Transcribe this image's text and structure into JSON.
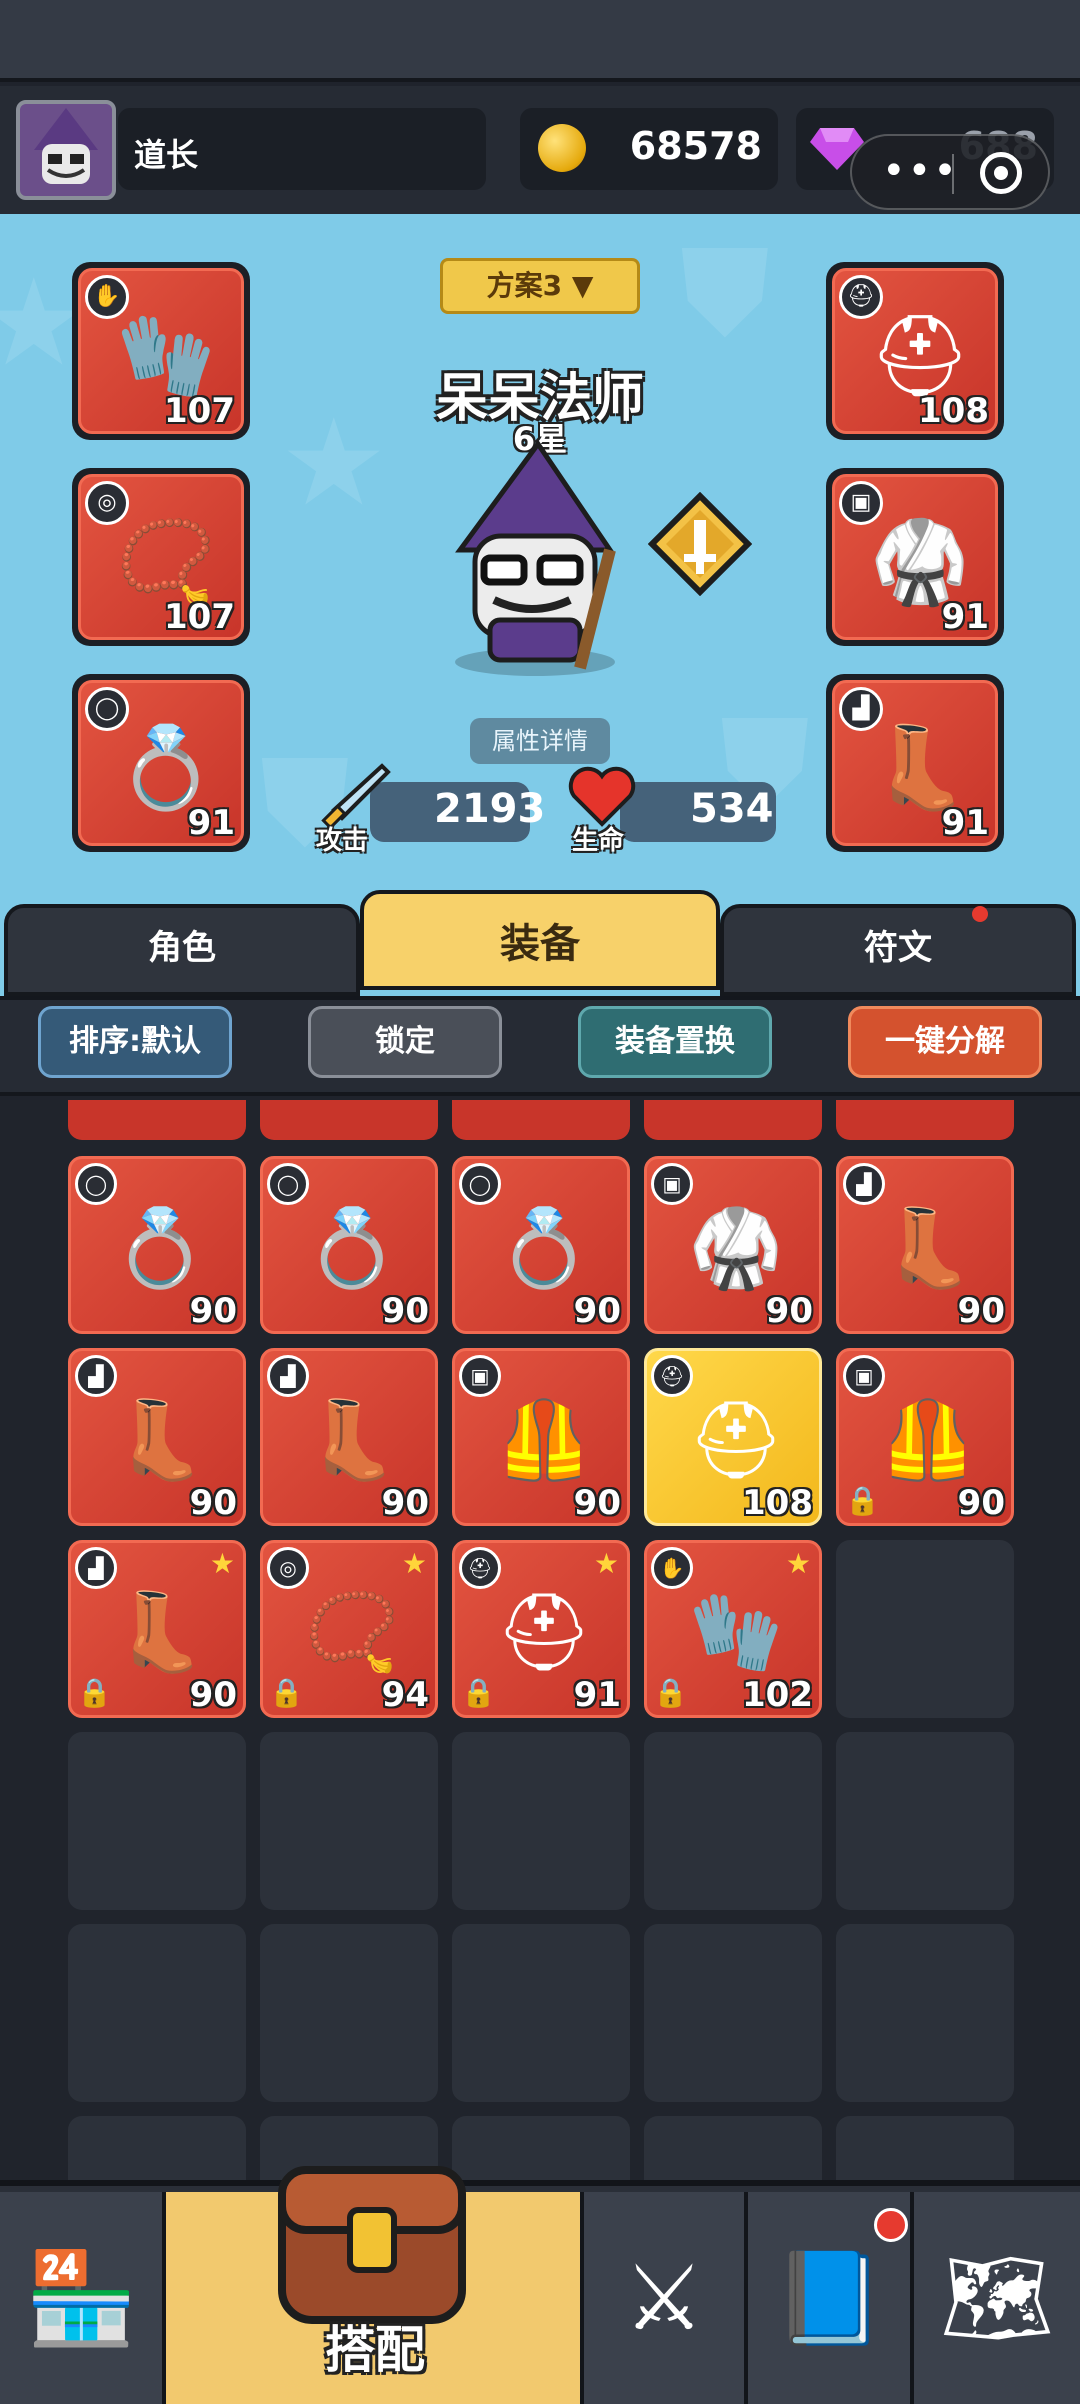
{
  "header": {
    "player_name": "道长",
    "gold": "68578",
    "gems": "688",
    "capsule_icons": [
      "more-dots-icon",
      "target-icon"
    ]
  },
  "hero": {
    "plan_label": "方案3 ▼",
    "name": "呆呆法师",
    "stars": "6星",
    "detail_button": "属性详情",
    "attack_label": "攻击",
    "attack_value": "2193",
    "hp_label": "生命",
    "hp_value": "534",
    "slots": {
      "gloves": {
        "level": "107",
        "icon": "gauntlet-icon"
      },
      "helmet": {
        "level": "108",
        "icon": "helmet-icon"
      },
      "necklace": {
        "level": "107",
        "icon": "amulet-icon"
      },
      "armor": {
        "level": "91",
        "icon": "robe-icon"
      },
      "ring": {
        "level": "91",
        "icon": "ring-icon"
      },
      "boots": {
        "level": "91",
        "icon": "boots-icon"
      }
    }
  },
  "tabs": [
    "角色",
    "装备",
    "符文"
  ],
  "active_tab": "装备",
  "toolbar": {
    "sort": "排序:默认",
    "lock": "锁定",
    "swap": "装备置换",
    "decompose": "一键分解"
  },
  "inventory": [
    {
      "level": "90",
      "type": "ring",
      "icon": "ring-icon"
    },
    {
      "level": "90",
      "type": "ring",
      "icon": "ring-icon"
    },
    {
      "level": "90",
      "type": "ring",
      "icon": "ring-icon"
    },
    {
      "level": "90",
      "type": "armor",
      "icon": "robe-icon"
    },
    {
      "level": "90",
      "type": "boots",
      "icon": "boots-icon"
    },
    {
      "level": "90",
      "type": "boots",
      "icon": "boots-icon"
    },
    {
      "level": "90",
      "type": "boots",
      "icon": "boots-icon"
    },
    {
      "level": "90",
      "type": "armor",
      "icon": "armor-icon"
    },
    {
      "level": "108",
      "type": "helmet",
      "icon": "helmet-icon",
      "gold": true
    },
    {
      "level": "90",
      "type": "armor",
      "icon": "armor-icon",
      "locked": true
    },
    {
      "level": "90",
      "type": "boots",
      "icon": "boots-icon",
      "locked": true,
      "star": true
    },
    {
      "level": "94",
      "type": "necklace",
      "icon": "amulet-icon",
      "locked": true,
      "star": true
    },
    {
      "level": "91",
      "type": "helmet",
      "icon": "helmet-icon",
      "locked": true,
      "star": true
    },
    {
      "level": "102",
      "type": "gloves",
      "icon": "gauntlet-icon",
      "locked": true,
      "star": true
    }
  ],
  "bottom_nav": {
    "items": [
      "shop-icon",
      "chest-icon",
      "swords-icon",
      "book-icon",
      "map-icon"
    ],
    "active_label": "搭配"
  },
  "colors": {
    "rare_bg": "#d9443a",
    "legendary_bg": "#f5c42a",
    "hero_bg": "#7fcbe8",
    "tab_active": "#f7d16a"
  }
}
